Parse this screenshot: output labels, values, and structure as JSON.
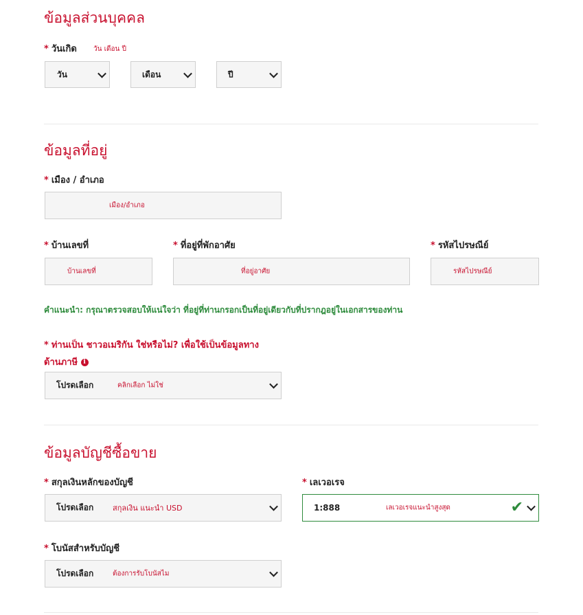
{
  "personal": {
    "heading": "ข้อมูลส่วนบุคคล",
    "birthdate_label": "วันเกิด",
    "birthdate_hint": "วัน เดือน ปี",
    "day": "วัน",
    "month": "เดือน",
    "year": "ปี"
  },
  "address": {
    "heading": "ข้อมูลที่อยู่",
    "city_label": "เมือง / อำเภอ",
    "city_hint": "เมือง/อำเภอ",
    "house_label": "บ้านเลขที่",
    "house_hint": "บ้านเลขที่",
    "street_label": "ที่อยู่ที่พักอาศัย",
    "street_hint": "ที่อยู่อาศัย",
    "zip_label": "รหัสไปรษณีย์",
    "zip_hint": "รหัสไปรษณีย์",
    "note": "คำแนะนำ: กรุณาตรวจสอบให้แน่ใจว่า ที่อยู่ที่ท่านกรอกเป็นที่อยู่เดียวกับที่ปรากฎอยู่ในเอกสารของท่าน",
    "us_question_line1": "ท่านเป็น ชาวอเมริกัน ใช่หรือไม่? เพื่อใช้เป็นข้อมูลทาง",
    "us_question_line2": "ด้านภาษี",
    "us_select": "โปรดเลือก",
    "us_hint": "คลิกเลือก ไม่ใช่"
  },
  "account": {
    "heading": "ข้อมูลบัญชีซื้อขาย",
    "currency_label": "สกุลเงินหลักของบัญชี",
    "currency_select": "โปรดเลือก",
    "currency_hint": "สกุลเงิน แนะนำ USD",
    "leverage_label": "เลเวอเรจ",
    "leverage_value": "1:888",
    "leverage_hint": "เลเวอเรจแนะนำสูงสุด",
    "bonus_label": "โบนัสสำหรับบัญชี",
    "bonus_select": "โปรดเลือก",
    "bonus_hint": "ต้องการรับโบนัสไม"
  },
  "required_mark": "*",
  "colors": {
    "accent": "#c8102e",
    "success": "#2e8b3c",
    "field_bg": "#f5f5f5"
  },
  "icons": {
    "valid": "check-icon",
    "dropdown": "chevron-down-icon",
    "info": "info-circle-icon"
  }
}
